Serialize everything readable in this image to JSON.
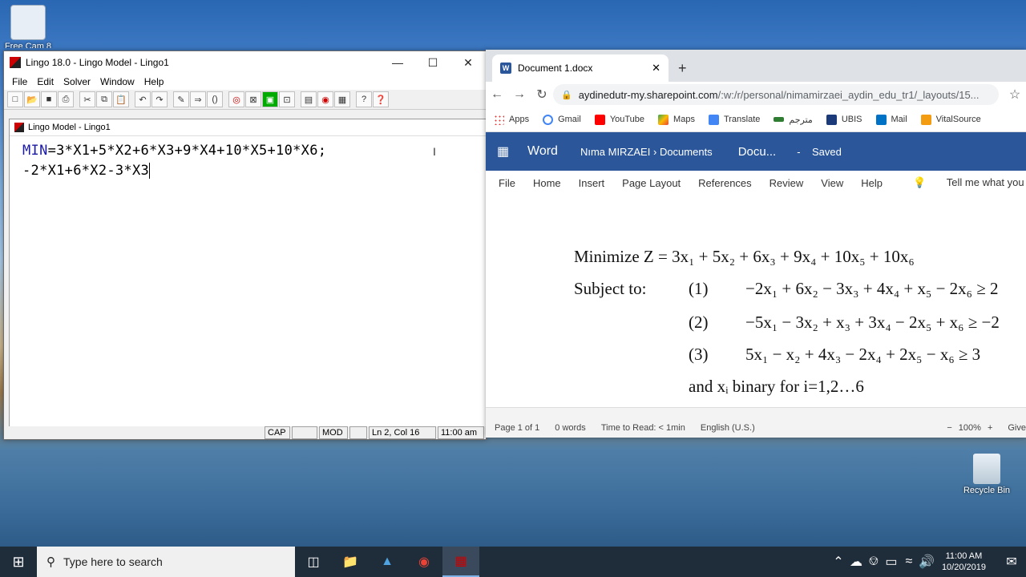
{
  "desktop": {
    "icons": [
      {
        "label": "Free Cam 8"
      },
      {
        "label": "Recycle Bin"
      }
    ]
  },
  "lingo": {
    "title": "Lingo 18.0 - Lingo Model - Lingo1",
    "menu": [
      "File",
      "Edit",
      "Solver",
      "Window",
      "Help"
    ],
    "doc_title": "Lingo Model - Lingo1",
    "editor": {
      "line1_keyword": "MIN",
      "line1_rest": "=3*X1+5*X2+6*X3+9*X4+10*X5+10*X6;",
      "line2": "-2*X1+6*X2-3*X3"
    },
    "status": {
      "cap": "CAP",
      "mod": "MOD",
      "position": "Ln 2, Col 16",
      "time": "11:00 am"
    }
  },
  "chrome": {
    "tab_title": "Document 1.docx",
    "url_host": "aydinedutr-my.sharepoint.com",
    "url_path": "/:w:/r/personal/nimamirzaei_aydin_edu_tr1/_layouts/15...",
    "bookmarks": [
      "Apps",
      "Gmail",
      "YouTube",
      "Maps",
      "Translate",
      "مترجم",
      "UBIS",
      "Mail",
      "VitalSource"
    ],
    "word": {
      "brand": "Word",
      "crumb_user": "Nıma MIRZAEI",
      "crumb_sep": "›",
      "crumb_folder": "Documents",
      "doc": "Docu...",
      "dash": "-",
      "saved": "Saved",
      "ribbon": [
        "File",
        "Home",
        "Insert",
        "Page Layout",
        "References",
        "Review",
        "View",
        "Help",
        "Tell me what you"
      ],
      "content": {
        "objective": "Minimize Z = 3x₁ + 5x₂ + 6x₃ + 9x₄ + 10x₅ + 10x₆",
        "subject_to": "Subject to:",
        "c1_num": "(1)",
        "c1": "−2x₁ + 6x₂ − 3x₃ + 4x₄ + x₅ − 2x₆ ≥ 2",
        "c2_num": "(2)",
        "c2": "−5x₁ − 3x₂ + x₃ + 3x₄ − 2x₅ + x₆ ≥ −2",
        "c3_num": "(3)",
        "c3": "5x₁ − x₂ + 4x₃ − 2x₄ + 2x₅ − x₆ ≥ 3",
        "binary": "and xᵢ binary for i=1,2…6"
      },
      "status": {
        "page": "Page 1 of 1",
        "words": "0 words",
        "read": "Time to Read: < 1min",
        "lang": "English (U.S.)",
        "zoom": "100%",
        "give": "Give"
      }
    }
  },
  "taskbar": {
    "search_placeholder": "Type here to search",
    "time": "11:00 AM",
    "date": "10/20/2019"
  }
}
